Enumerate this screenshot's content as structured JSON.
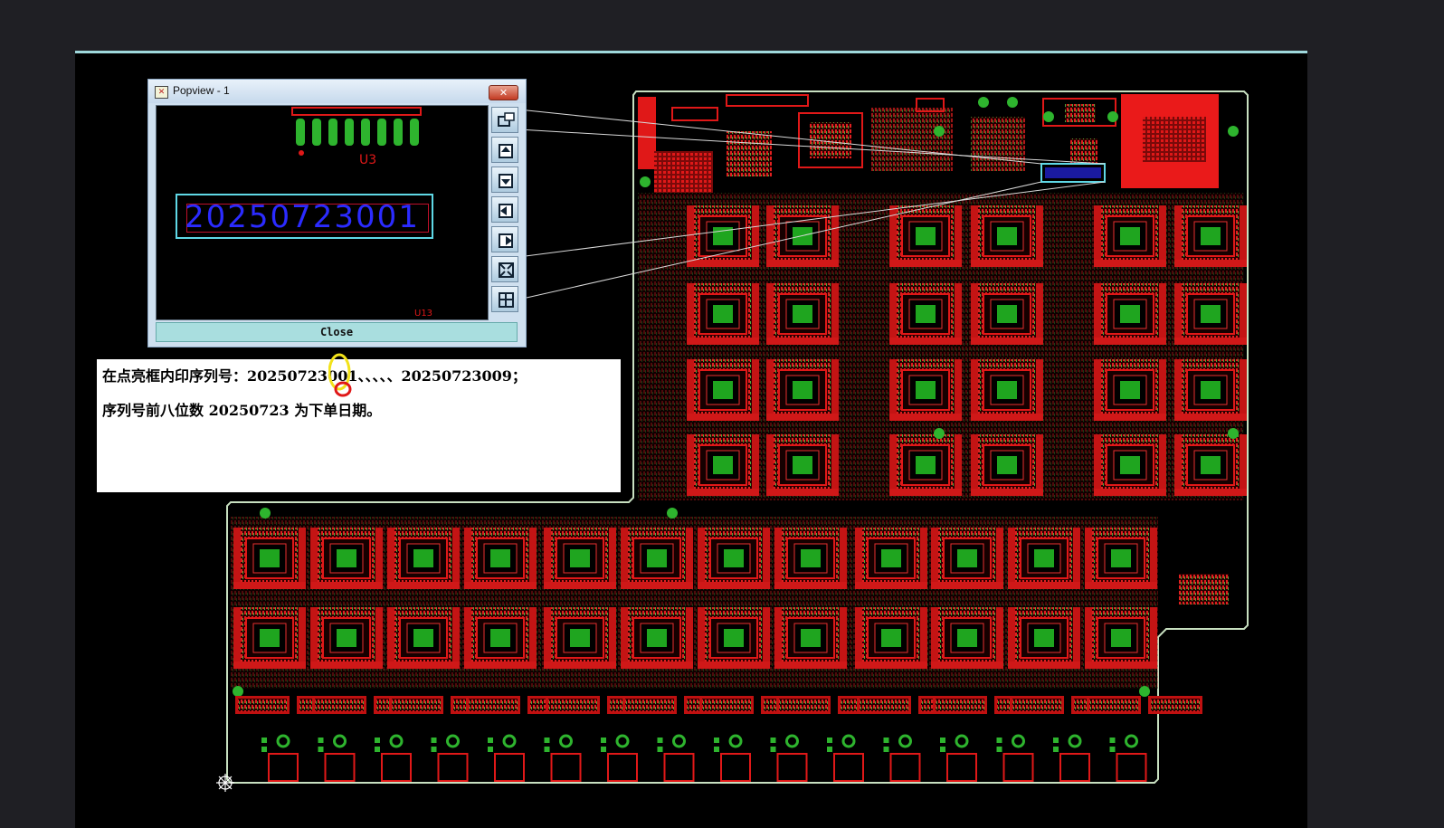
{
  "popview": {
    "title": "Popview - 1",
    "close_label": "Close",
    "serial_text": "20250723001",
    "refdes": "U3",
    "toolbar": [
      "zoom-window-icon",
      "zoom-in-icon",
      "zoom-out-icon",
      "pan-left-icon",
      "pan-right-icon",
      "zoom-fit-icon",
      "zoom-world-icon"
    ]
  },
  "note": {
    "line1": "在点亮框内印序列号：20250723001、、、、、20250723009；",
    "line2": "序列号前八位数 20250723 为下单日期。"
  },
  "colors": {
    "background": "#000000",
    "copper": "#e01818",
    "pad": "#22a31f",
    "outline": "#c8e0c0",
    "highlight": "#5fd8e6",
    "silk_text": "#2b2bff"
  }
}
